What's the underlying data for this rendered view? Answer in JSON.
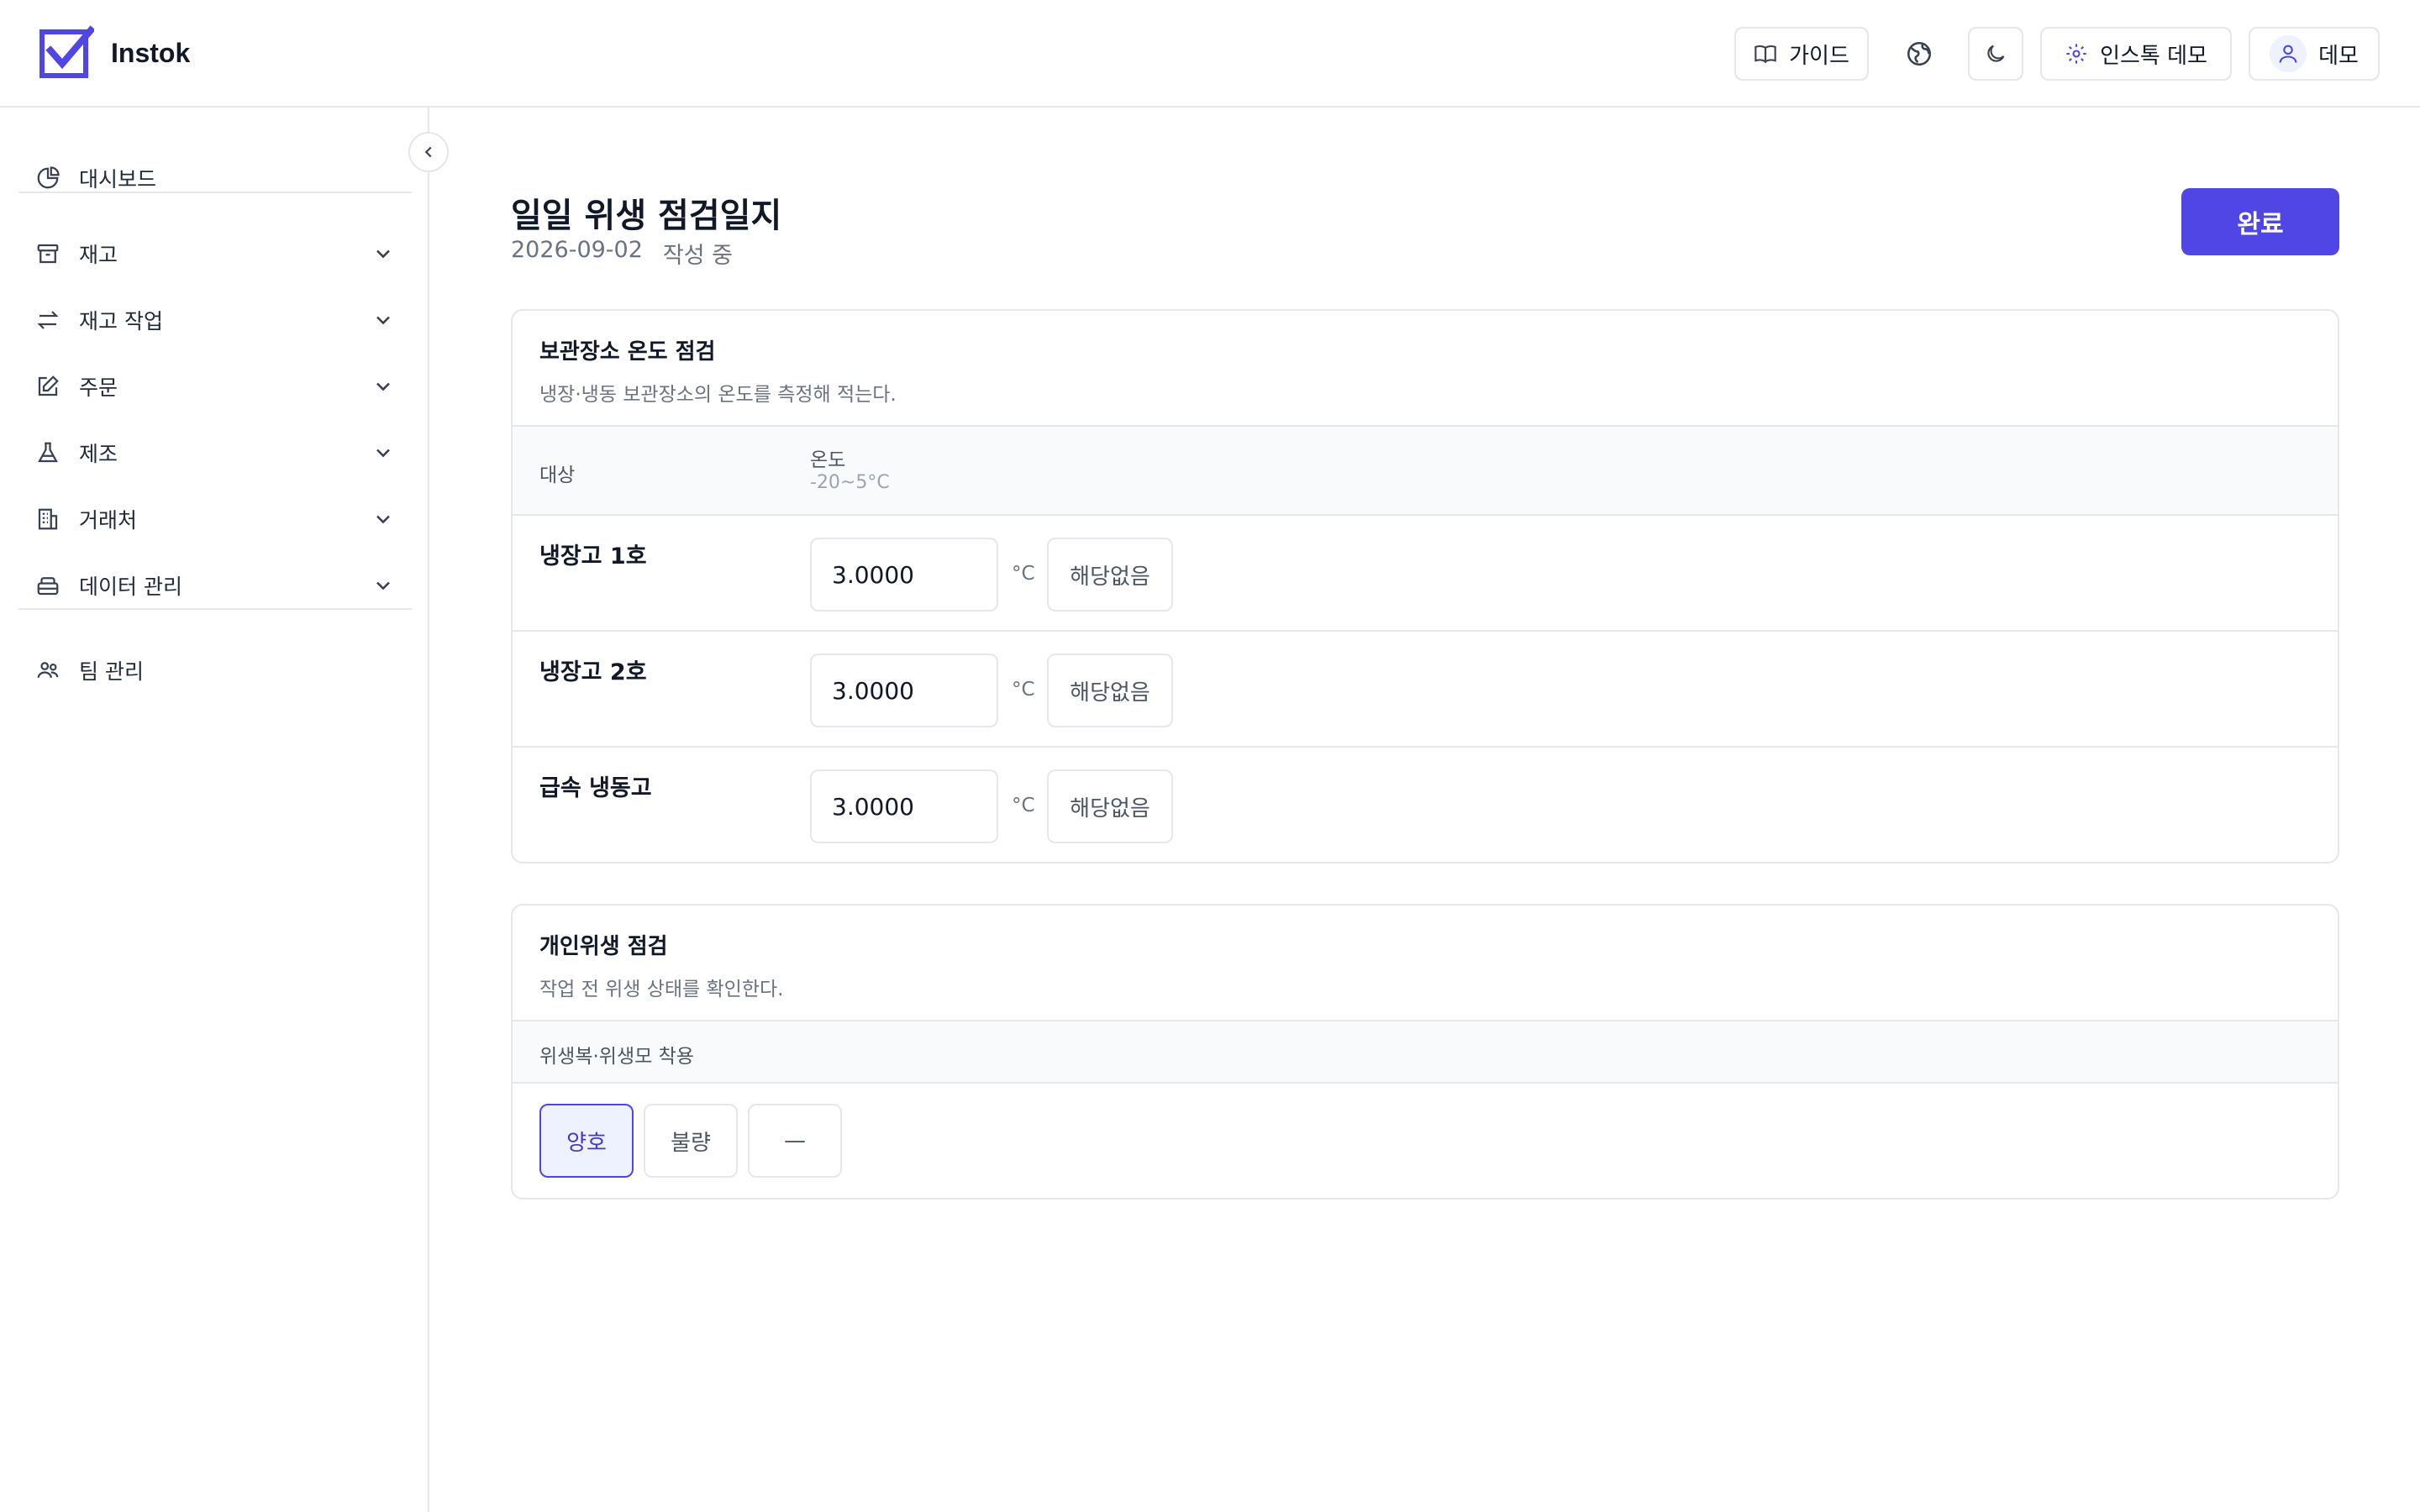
{
  "app": {
    "name": "Instok"
  },
  "colors": {
    "accent": "#4f46e5",
    "accent_light": "#eef2ff",
    "border": "#e5e7eb"
  },
  "header": {
    "guide_label": "가이드",
    "workspace_label": "인스톡 데모",
    "user_label": "데모",
    "icons": [
      "book-icon",
      "globe-icon",
      "moon-icon",
      "gear-icon",
      "user-icon"
    ]
  },
  "sidebar": {
    "items": [
      {
        "label": "대시보드",
        "icon": "pie-chart-icon",
        "expandable": false
      },
      {
        "label": "재고",
        "icon": "archive-icon",
        "expandable": true
      },
      {
        "label": "재고 작업",
        "icon": "arrows-exchange-icon",
        "expandable": true
      },
      {
        "label": "주문",
        "icon": "edit-icon",
        "expandable": true
      },
      {
        "label": "제조",
        "icon": "flask-icon",
        "expandable": true
      },
      {
        "label": "거래처",
        "icon": "building-icon",
        "expandable": true
      },
      {
        "label": "데이터 관리",
        "icon": "database-icon",
        "expandable": true
      },
      {
        "label": "팀 관리",
        "icon": "team-icon",
        "expandable": false
      }
    ]
  },
  "page": {
    "title": "일일 위생 점검일지",
    "date": "2026-09-02",
    "status": "작성 중",
    "complete_label": "완료"
  },
  "storage_section": {
    "title": "보관장소 온도 점검",
    "description": "냉장·냉동 보관장소의 온도를 측정해 적는다.",
    "col_target": "대상",
    "col_temp": "온도",
    "col_temp_range": "-20~5°C",
    "unit": "°C",
    "na_label": "해당없음",
    "rows": [
      {
        "label": "냉장고 1호",
        "value": "3.0000"
      },
      {
        "label": "냉장고 2호",
        "value": "3.0000"
      },
      {
        "label": "급속 냉동고",
        "value": "3.0000"
      }
    ]
  },
  "hygiene_section": {
    "title": "개인위생 점검",
    "description": "작업 전 위생 상태를 확인한다.",
    "item_label": "위생복·위생모 착용",
    "options": [
      "양호",
      "불량",
      "—"
    ],
    "selected": "양호"
  }
}
